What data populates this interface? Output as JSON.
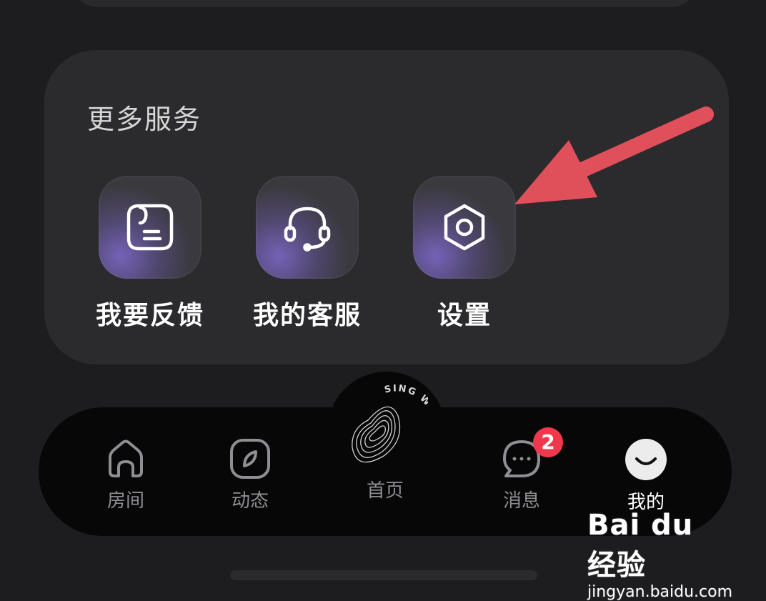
{
  "services": {
    "title": "更多服务",
    "items": [
      {
        "label": "我要反馈",
        "icon": "feedback-icon"
      },
      {
        "label": "我的客服",
        "icon": "headset-icon"
      },
      {
        "label": "设置",
        "icon": "settings-icon"
      }
    ]
  },
  "tabbar": {
    "tabs": [
      {
        "label": "房间",
        "icon": "house-icon",
        "active": false
      },
      {
        "label": "动态",
        "icon": "compass-icon",
        "active": false
      },
      {
        "label": "首页",
        "icon": "sing-with-me-logo",
        "active": false
      },
      {
        "label": "消息",
        "icon": "chat-bubble-icon",
        "active": false,
        "badge": "2"
      },
      {
        "label": "我的",
        "icon": "smile-avatar-icon",
        "active": true
      }
    ],
    "center_logo_text": "SING WITH ME"
  },
  "annotation": {
    "arrow_color": "#e0505a"
  },
  "watermark": {
    "brand": "Bai du 经验",
    "url": "jingyan.baidu.com"
  },
  "colors": {
    "badge": "#f0384c",
    "background": "#1d1d1f",
    "card": "#2b2b2d"
  }
}
